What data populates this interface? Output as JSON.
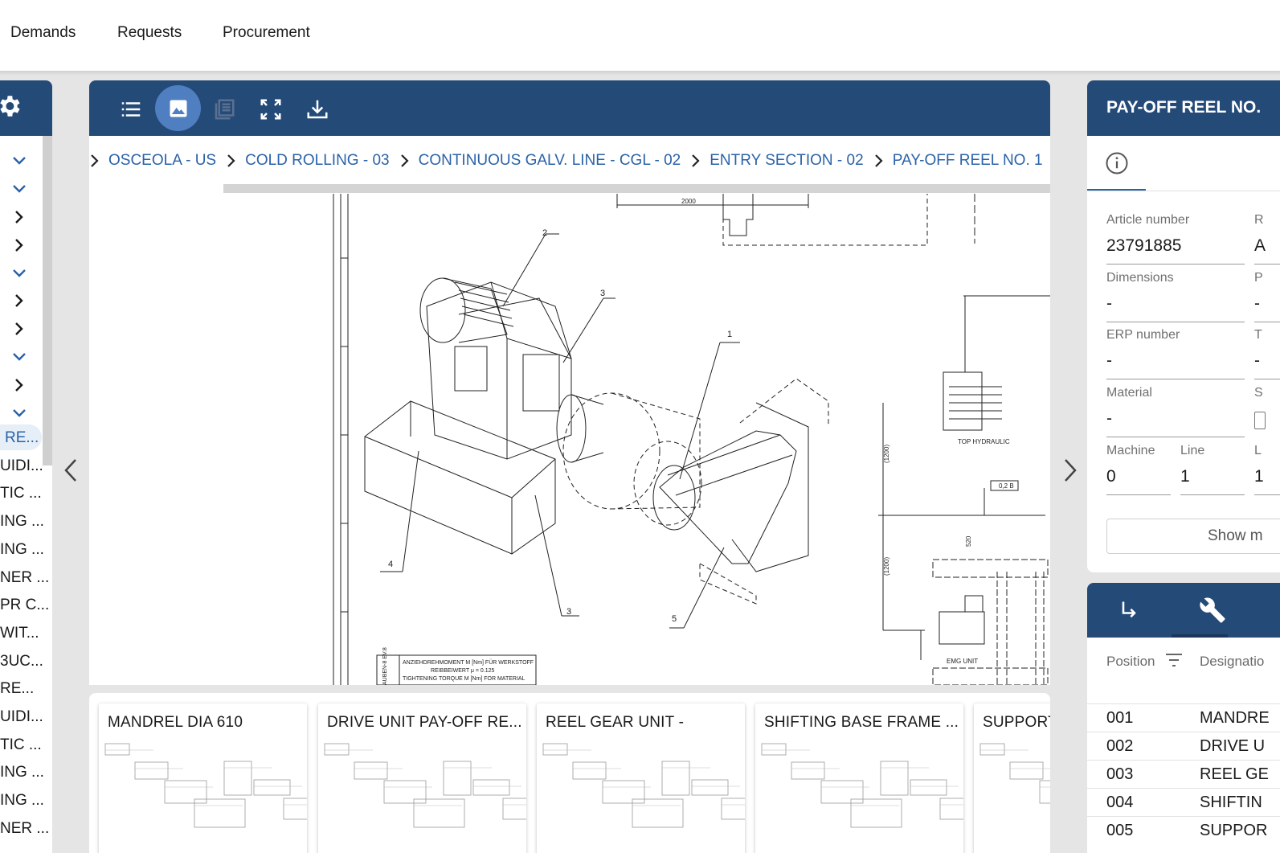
{
  "topnav": {
    "items": [
      "Demands",
      "Requests",
      "Procurement"
    ]
  },
  "sidebar": {
    "items": [
      "RE...",
      "UIDI...",
      "TIC ...",
      "ING ...",
      "ING ...",
      "NER ...",
      "PR C...",
      "WIT...",
      "3UC...",
      "RE...",
      "UIDI...",
      "TIC ...",
      "ING ...",
      "ING ...",
      "NER ..."
    ]
  },
  "breadcrumbs": [
    "OSCEOLA - US",
    "COLD ROLLING - 03",
    "CONTINUOUS GALV. LINE - CGL - 02",
    "ENTRY SECTION - 02",
    "PAY-OFF REEL NO. 1"
  ],
  "drawing": {
    "labels": [
      "2000",
      "2",
      "3",
      "1",
      "4",
      "3",
      "5",
      "TOP HYDRAULIC",
      "EMG UNIT",
      "(1200)",
      "(1200)",
      "520",
      "0,2 B"
    ],
    "table_lines": [
      "ANZIEHDREHMOMENT M  [Nm] FÜR WERKSTOFF",
      "REIBBEIWERT  μ = 0.125",
      "TIGHTENING TORQUE M  [Nm] FOR MATERIAL"
    ],
    "side_text": "AUBEN-8 EV.8"
  },
  "thumbnails": [
    "MANDREL DIA 610",
    "DRIVE UNIT PAY-OFF RE...",
    "REEL GEAR UNIT -",
    "SHIFTING BASE FRAME ...",
    "SUPPORT"
  ],
  "details": {
    "title": "PAY-OFF REEL NO.",
    "fields": {
      "article_number": {
        "label": "Article number",
        "value": "23791885"
      },
      "dimensions": {
        "label": "Dimensions",
        "value": "-"
      },
      "erp_number": {
        "label": "ERP number",
        "value": "-"
      },
      "material": {
        "label": "Material",
        "value": "-"
      },
      "machine": {
        "label": "Machine",
        "value": "0"
      },
      "line": {
        "label": "Line",
        "value": "1"
      }
    },
    "truncated_col": {
      "r1_label": "R",
      "r1_value": "A",
      "r2_label": "P",
      "r2_value": "-",
      "r3_label": "T",
      "r3_value": "-",
      "r4_label": "S",
      "r5_label": "L",
      "r5_value": "1"
    },
    "show_more": "Show m"
  },
  "bom": {
    "col_position": "Position",
    "col_designation": "Designatio",
    "rows": [
      {
        "position": "001",
        "designation": "MANDRE"
      },
      {
        "position": "002",
        "designation": "DRIVE U"
      },
      {
        "position": "003",
        "designation": "REEL GE"
      },
      {
        "position": "004",
        "designation": "SHIFTIN"
      },
      {
        "position": "005",
        "designation": "SUPPOR"
      }
    ]
  },
  "colors": {
    "header": "#244a78",
    "link": "#2a62a8",
    "active_tool": "#4f7fc0"
  }
}
